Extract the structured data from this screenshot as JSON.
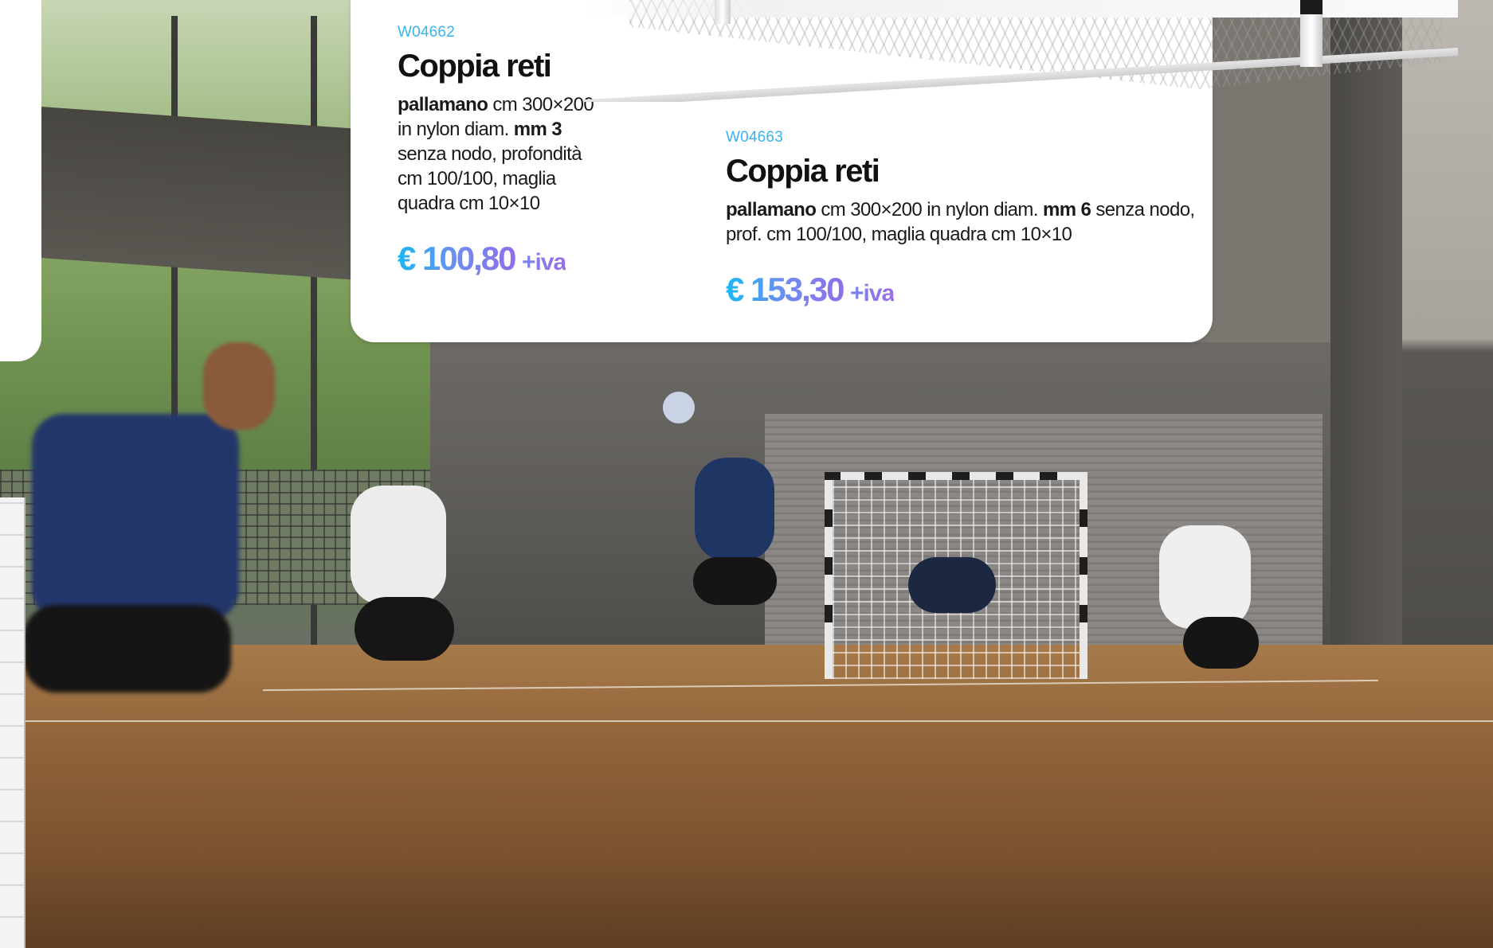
{
  "colors": {
    "code": "#38b3f0",
    "price_gradient_start": "#1ab8f5",
    "price_gradient_end": "#8f6fe8",
    "card_background": "#ffffff"
  },
  "products": [
    {
      "code": "W04662",
      "title": "Coppia reti",
      "desc_bold_1": "pallamano",
      "desc_text_1": " cm 300×200 in nylon diam. ",
      "desc_bold_2": "mm 3",
      "desc_text_2": " senza nodo, profondità cm 100/100, maglia quadra cm 10×10",
      "price": "€ 100,80",
      "vat": "+iva"
    },
    {
      "code": "W04663",
      "title": "Coppia reti",
      "desc_bold_1": "pallamano",
      "desc_text_1": " cm 300×200 in nylon diam. ",
      "desc_bold_2": "mm 6",
      "desc_text_2": " senza nodo, prof. cm 100/100, maglia quadra cm 10×10",
      "price": "€ 153,30",
      "vat": "+iva"
    }
  ],
  "images": {
    "background_photo": "handball-match-indoor-photo",
    "product_photo": "handball-goal-net-photo"
  }
}
